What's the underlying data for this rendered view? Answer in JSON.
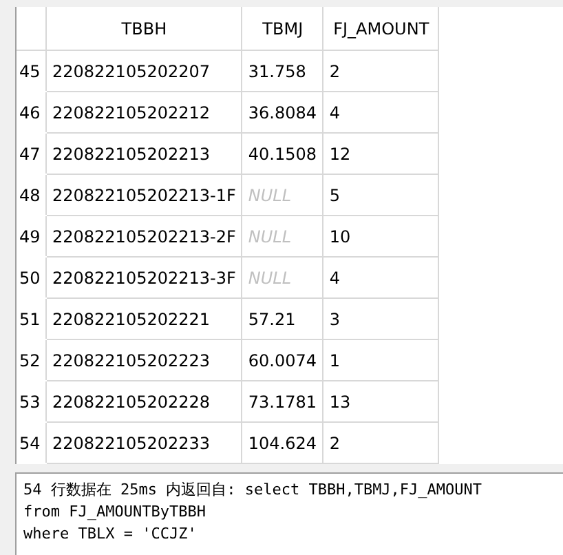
{
  "table": {
    "columns": [
      "TBBH",
      "TBMJ",
      "FJ_AMOUNT"
    ],
    "rows": [
      {
        "number": "45",
        "cells": [
          {
            "kind": "value",
            "text": "220822105202207"
          },
          {
            "kind": "value",
            "text": "31.758"
          },
          {
            "kind": "value",
            "text": "2"
          }
        ]
      },
      {
        "number": "46",
        "cells": [
          {
            "kind": "value",
            "text": "220822105202212"
          },
          {
            "kind": "value",
            "text": "36.8084"
          },
          {
            "kind": "value",
            "text": "4"
          }
        ]
      },
      {
        "number": "47",
        "cells": [
          {
            "kind": "value",
            "text": "220822105202213"
          },
          {
            "kind": "value",
            "text": "40.1508"
          },
          {
            "kind": "value",
            "text": "12"
          }
        ]
      },
      {
        "number": "48",
        "cells": [
          {
            "kind": "value",
            "text": "220822105202213-1F"
          },
          {
            "kind": "null",
            "text": "NULL"
          },
          {
            "kind": "value",
            "text": "5"
          }
        ]
      },
      {
        "number": "49",
        "cells": [
          {
            "kind": "value",
            "text": "220822105202213-2F"
          },
          {
            "kind": "null",
            "text": "NULL"
          },
          {
            "kind": "value",
            "text": "10"
          }
        ]
      },
      {
        "number": "50",
        "cells": [
          {
            "kind": "value",
            "text": "220822105202213-3F"
          },
          {
            "kind": "null",
            "text": "NULL"
          },
          {
            "kind": "value",
            "text": "4"
          }
        ]
      },
      {
        "number": "51",
        "cells": [
          {
            "kind": "value",
            "text": "220822105202221"
          },
          {
            "kind": "value",
            "text": "57.21"
          },
          {
            "kind": "value",
            "text": "3"
          }
        ]
      },
      {
        "number": "52",
        "cells": [
          {
            "kind": "value",
            "text": "220822105202223"
          },
          {
            "kind": "value",
            "text": "60.0074"
          },
          {
            "kind": "value",
            "text": "1"
          }
        ]
      },
      {
        "number": "53",
        "cells": [
          {
            "kind": "value",
            "text": "220822105202228"
          },
          {
            "kind": "value",
            "text": "73.1781"
          },
          {
            "kind": "value",
            "text": "13"
          }
        ]
      },
      {
        "number": "54",
        "cells": [
          {
            "kind": "value",
            "text": "220822105202233"
          },
          {
            "kind": "value",
            "text": "104.624"
          },
          {
            "kind": "value",
            "text": "2"
          }
        ]
      }
    ]
  },
  "message": "54 行数据在 25ms 内返回自: select TBBH,TBMJ,FJ_AMOUNT\nfrom FJ_AMOUNTByTBBH\nwhere TBLX = 'CCJZ'"
}
